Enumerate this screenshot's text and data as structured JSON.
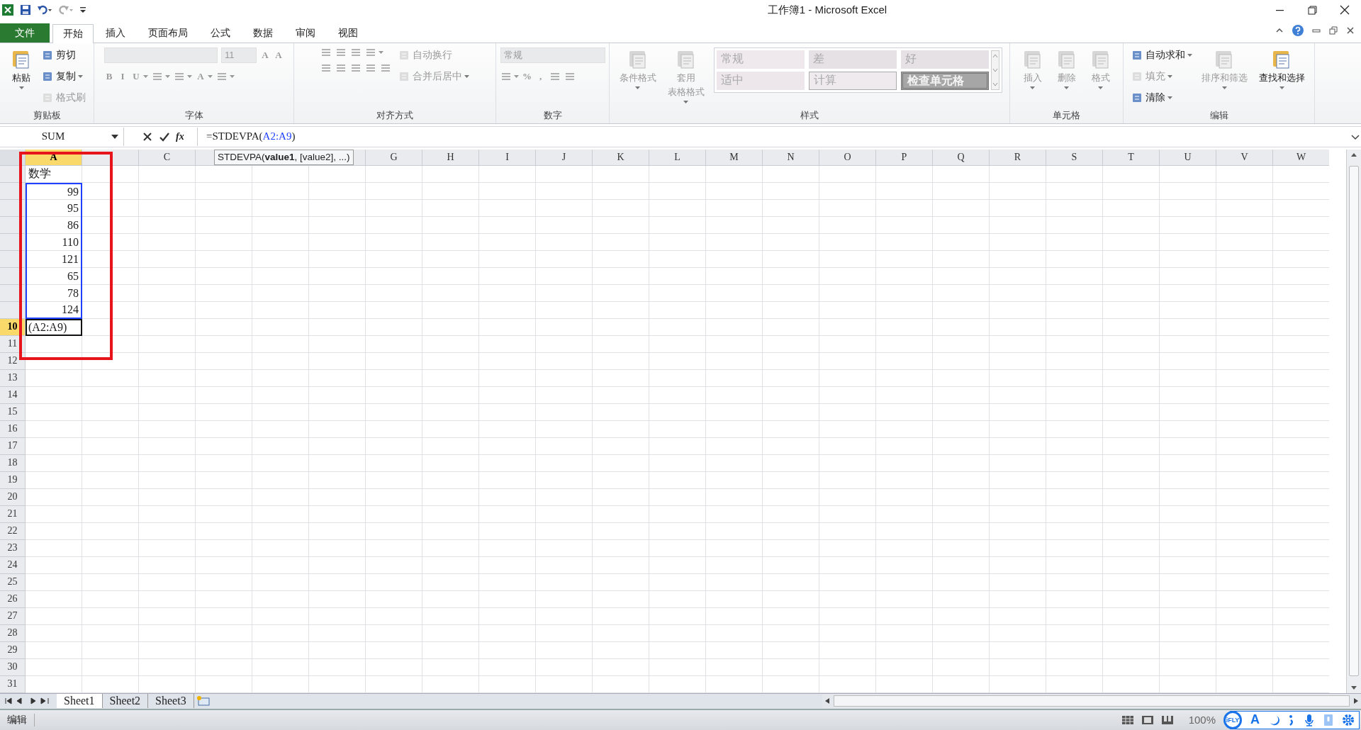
{
  "window": {
    "title": "工作簿1 - Microsoft Excel"
  },
  "ribbon_tabs": [
    {
      "label": "文件",
      "selected": false,
      "kind": "file"
    },
    {
      "label": "开始",
      "selected": true,
      "kind": "tab"
    },
    {
      "label": "插入",
      "selected": false,
      "kind": "tab"
    },
    {
      "label": "页面布局",
      "selected": false,
      "kind": "tab"
    },
    {
      "label": "公式",
      "selected": false,
      "kind": "tab"
    },
    {
      "label": "数据",
      "selected": false,
      "kind": "tab"
    },
    {
      "label": "审阅",
      "selected": false,
      "kind": "tab"
    },
    {
      "label": "视图",
      "selected": false,
      "kind": "tab"
    }
  ],
  "ribbon_groups": [
    {
      "label": "剪贴板",
      "blocks": [
        [
          [
            {
              "kind": "large",
              "label": "粘贴",
              "dropdown": true,
              "disabled": false
            }
          ]
        ],
        [
          [
            {
              "kind": "small",
              "label": "剪切",
              "disabled": false
            }
          ],
          [
            {
              "kind": "small",
              "label": "复制",
              "dropdown": true,
              "disabled": false
            }
          ],
          [
            {
              "kind": "small",
              "label": "格式刷",
              "disabled": true
            }
          ]
        ]
      ]
    },
    {
      "label": "字体",
      "blocks": [
        [
          [
            {
              "kind": "combo",
              "disabled": true
            },
            {
              "kind": "combo",
              "label": "11",
              "disabled": true
            },
            {
              "kind": "glyph",
              "label": "A",
              "disabled": true
            },
            {
              "kind": "glyph",
              "label": "A",
              "disabled": true
            }
          ],
          [
            {
              "kind": "glyph",
              "label": "B",
              "disabled": true
            },
            {
              "kind": "glyph",
              "label": "I",
              "disabled": true
            },
            {
              "kind": "glyph",
              "label": "U",
              "dropdown": true,
              "disabled": true
            },
            {
              "kind": "icon",
              "dropdown": true,
              "disabled": true
            },
            {
              "kind": "icon",
              "dropdown": true,
              "disabled": true
            },
            {
              "kind": "glyph",
              "label": "A",
              "dropdown": true,
              "disabled": true
            },
            {
              "kind": "icon",
              "dropdown": true,
              "disabled": true
            }
          ]
        ]
      ]
    },
    {
      "label": "对齐方式",
      "blocks": [
        [
          [
            {
              "kind": "icon",
              "disabled": true
            },
            {
              "kind": "icon",
              "disabled": true
            },
            {
              "kind": "icon",
              "disabled": true
            },
            {
              "kind": "icon",
              "dropdown": true,
              "disabled": true
            }
          ],
          [
            {
              "kind": "icon",
              "disabled": true
            },
            {
              "kind": "icon",
              "disabled": true
            },
            {
              "kind": "icon",
              "disabled": true
            },
            {
              "kind": "icon",
              "disabled": true
            },
            {
              "kind": "icon",
              "disabled": true
            }
          ]
        ],
        [
          [
            {
              "kind": "small",
              "label": "自动换行",
              "disabled": true
            }
          ],
          [
            {
              "kind": "small",
              "label": "合并后居中",
              "dropdown": true,
              "disabled": true
            }
          ]
        ]
      ]
    },
    {
      "label": "数字",
      "blocks": [
        [
          [
            {
              "kind": "combo",
              "label": "常规",
              "disabled": true
            }
          ],
          [
            {
              "kind": "icon",
              "dropdown": true,
              "disabled": true
            },
            {
              "kind": "glyph",
              "label": "%",
              "disabled": true
            },
            {
              "kind": "glyph",
              "label": ",",
              "disabled": true
            },
            {
              "kind": "icon",
              "disabled": true
            },
            {
              "kind": "icon",
              "disabled": true
            }
          ]
        ]
      ]
    },
    {
      "label": "样式",
      "blocks": [
        [
          [
            {
              "kind": "large",
              "label": "条件格式",
              "dropdown": true,
              "disabled": true
            }
          ]
        ],
        [
          [
            {
              "kind": "large",
              "label": "套用",
              "label2": "表格格式",
              "dropdown": true,
              "disabled": true
            }
          ]
        ],
        [
          [
            {
              "kind": "gallery",
              "disabled": true,
              "styles": [
                {
                  "label": "常规",
                  "kind": "normal"
                },
                {
                  "label": "差",
                  "kind": "bad"
                },
                {
                  "label": "好",
                  "kind": "good"
                },
                {
                  "label": "适中",
                  "kind": "neutral"
                },
                {
                  "label": "计算",
                  "kind": "calculation"
                },
                {
                  "label": "检查单元格",
                  "kind": "check"
                }
              ]
            }
          ]
        ]
      ]
    },
    {
      "label": "单元格",
      "blocks": [
        [
          [
            {
              "kind": "large",
              "label": "插入",
              "dropdown": true,
              "disabled": true
            }
          ]
        ],
        [
          [
            {
              "kind": "large",
              "label": "删除",
              "dropdown": true,
              "disabled": true
            }
          ]
        ],
        [
          [
            {
              "kind": "large",
              "label": "格式",
              "dropdown": true,
              "disabled": true
            }
          ]
        ]
      ]
    },
    {
      "label": "编辑",
      "blocks": [
        [
          [
            {
              "kind": "small",
              "label": "自动求和",
              "dropdown": true,
              "disabled": false
            }
          ],
          [
            {
              "kind": "small",
              "label": "填充",
              "dropdown": true,
              "disabled": true
            }
          ],
          [
            {
              "kind": "small",
              "label": "清除",
              "dropdown": true,
              "disabled": false
            }
          ]
        ],
        [
          [
            {
              "kind": "large",
              "label": "排序和筛选",
              "dropdown": true,
              "disabled": true
            }
          ]
        ],
        [
          [
            {
              "kind": "large",
              "label": "查找和选择",
              "dropdown": true,
              "disabled": false
            }
          ]
        ]
      ]
    }
  ],
  "formula_bar": {
    "name_box": "SUM",
    "fx": "fx",
    "formula_start": "=STDEVPA(",
    "formula_reference": "A2:A9",
    "formula_end": ")"
  },
  "tooltip": "STDEVPA(**value1**, [value2], ...)",
  "columns": [
    {
      "label": "A",
      "selected": true,
      "kind": "header"
    },
    {
      "kind": "covered"
    },
    {
      "label": "C",
      "selected": false,
      "kind": "header"
    },
    {
      "kind": "covered"
    },
    {
      "kind": "covered"
    },
    {
      "kind": "covered"
    },
    {
      "label": "G",
      "selected": false
    },
    {
      "label": "H",
      "selected": false
    },
    {
      "label": "I",
      "selected": false
    },
    {
      "label": "J",
      "selected": false
    },
    {
      "label": "K",
      "selected": false
    },
    {
      "label": "L",
      "selected": false
    },
    {
      "label": "M",
      "selected": false
    },
    {
      "label": "N",
      "selected": false
    },
    {
      "label": "O",
      "selected": false
    },
    {
      "label": "P",
      "selected": false
    },
    {
      "label": "Q",
      "selected": false
    },
    {
      "label": "R",
      "selected": false
    },
    {
      "label": "S",
      "selected": false
    },
    {
      "label": "T",
      "selected": false
    },
    {
      "label": "U",
      "selected": false
    },
    {
      "label": "V",
      "selected": false
    },
    {
      "label": "W",
      "selected": false
    }
  ],
  "rows": [
    {
      "selected": false
    },
    {
      "selected": false
    },
    {
      "selected": false
    },
    {
      "selected": false
    },
    {
      "selected": false
    },
    {
      "selected": false
    },
    {
      "selected": false
    },
    {
      "selected": false
    },
    {
      "selected": false
    },
    {
      "label": "10",
      "selected": true
    },
    {
      "label": "11",
      "selected": false
    },
    {
      "label": "12",
      "selected": false
    },
    {
      "label": "13",
      "selected": false
    },
    {
      "label": "14",
      "selected": false
    },
    {
      "label": "15",
      "selected": false
    },
    {
      "label": "16",
      "selected": false
    },
    {
      "label": "17",
      "selected": false
    },
    {
      "label": "18",
      "selected": false
    },
    {
      "label": "19",
      "selected": false
    },
    {
      "label": "20",
      "selected": false
    },
    {
      "label": "21",
      "selected": false
    },
    {
      "label": "22",
      "selected": false
    },
    {
      "label": "23",
      "selected": false
    },
    {
      "label": "24",
      "selected": false
    },
    {
      "label": "25",
      "selected": false
    },
    {
      "label": "26",
      "selected": false
    },
    {
      "label": "27",
      "selected": false
    },
    {
      "label": "28",
      "selected": false
    },
    {
      "label": "29",
      "selected": false
    },
    {
      "label": "30",
      "selected": false
    },
    {
      "label": "31",
      "selected": false
    }
  ],
  "column_a_cells": [
    {
      "value": "数学",
      "kind": "text",
      "referenced": false
    },
    {
      "value": "99",
      "kind": "number",
      "referenced": true
    },
    {
      "value": "95",
      "kind": "number",
      "referenced": true
    },
    {
      "value": "86",
      "kind": "number",
      "referenced": true
    },
    {
      "value": "110",
      "kind": "number",
      "referenced": true
    },
    {
      "value": "121",
      "kind": "number",
      "referenced": true
    },
    {
      "value": "65",
      "kind": "number",
      "referenced": true
    },
    {
      "value": "78",
      "kind": "number",
      "referenced": true
    },
    {
      "value": "124",
      "kind": "number",
      "referenced": true
    },
    {
      "value": "(A2:A9)",
      "kind": "editing",
      "referenced": false
    }
  ],
  "sheet_tabs": [
    {
      "label": "Sheet1",
      "selected": true
    },
    {
      "label": "Sheet2",
      "selected": false
    },
    {
      "label": "Sheet3",
      "selected": false
    }
  ],
  "status_bar": {
    "mode": "编辑",
    "zoom": "100%"
  },
  "ime_toolbar": {
    "logo": "iFLY",
    "font_key": "A"
  }
}
